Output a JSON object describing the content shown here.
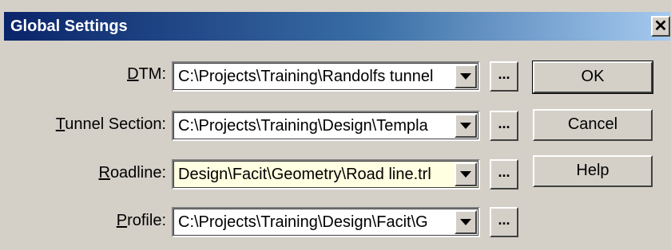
{
  "window": {
    "title": "Global Settings",
    "close_glyph": "✕"
  },
  "fields": [
    {
      "label_mnemonic": "D",
      "label_rest": "TM:",
      "value": "C:\\Projects\\Training\\Randolfs tunnel"
    },
    {
      "label_mnemonic": "T",
      "label_rest": "unnel Section:",
      "value": "C:\\Projects\\Training\\Design\\Templa"
    },
    {
      "label_mnemonic": "R",
      "label_rest": "oadline:",
      "value": "Design\\Facit\\Geometry\\Road line.trl"
    },
    {
      "label_mnemonic": "P",
      "label_rest": "rofile:",
      "value": "C:\\Projects\\Training\\Design\\Facit\\G"
    }
  ],
  "browse_label": "...",
  "buttons": {
    "ok": "OK",
    "cancel": "Cancel",
    "help": "Help"
  },
  "colors": {
    "title_gradient_start": "#0a246a",
    "title_gradient_end": "#a6caf0",
    "face": "#d4d0c8",
    "focused_field_bg": "#ffffe1"
  }
}
